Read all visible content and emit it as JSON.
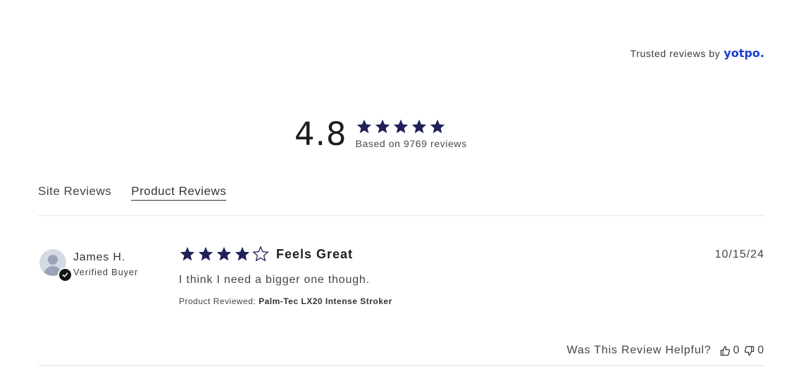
{
  "header": {
    "trusted_text": "Trusted reviews by",
    "brand": "yotpo.",
    "brand_color": "#1a3fcf"
  },
  "summary": {
    "average": "4.8",
    "stars_filled": 5,
    "based_on": "Based on 9769 reviews",
    "star_color": "#1f2158"
  },
  "tabs": [
    {
      "label": "Site Reviews",
      "active": false
    },
    {
      "label": "Product Reviews",
      "active": true
    }
  ],
  "review": {
    "reviewer_name": "James H.",
    "badge": "Verified Buyer",
    "rating": 4,
    "rating_max": 5,
    "title": "Feels Great",
    "body": "I think I need a bigger one though.",
    "product_label": "Product Reviewed:",
    "product_name": "Palm-Tec LX20 Intense Stroker",
    "date": "10/15/24",
    "helpful_label": "Was This Review Helpful?",
    "upvotes": "0",
    "downvotes": "0",
    "icons": {
      "avatar": "user-avatar-icon",
      "verified": "checkmark-icon",
      "upvote": "thumbs-up-icon",
      "downvote": "thumbs-down-icon"
    }
  }
}
